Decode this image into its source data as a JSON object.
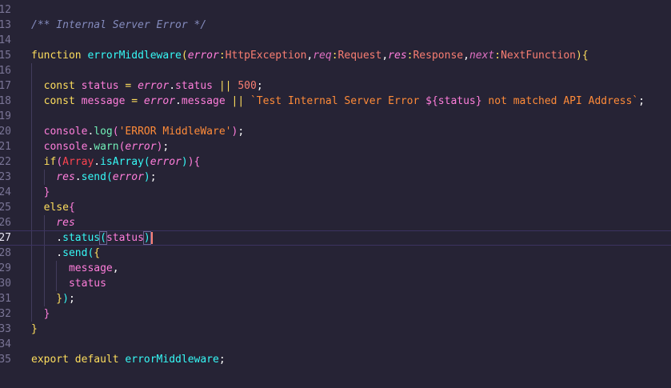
{
  "editor": {
    "language": "typescript",
    "active_line": "27",
    "colors": {
      "background": "#262335",
      "line_number": "#7a7596",
      "comment": "#848bbd",
      "keyword": "#fede5d",
      "function": "#36f9f6",
      "parameter": "#ff7edb",
      "type": "#fe4450",
      "string": "#ff8b39",
      "number": "#f97e72",
      "cursor": "#f97e72"
    },
    "lines": [
      {
        "num": "12",
        "tokens": []
      },
      {
        "num": "13",
        "tokens": [
          {
            "t": "/** Internal Server Error */",
            "c": "t-comment"
          }
        ]
      },
      {
        "num": "14",
        "tokens": []
      },
      {
        "num": "15",
        "tokens": [
          {
            "t": "function ",
            "c": "t-kw"
          },
          {
            "t": "errorMiddleware",
            "c": "t-fn"
          },
          {
            "t": "(",
            "c": "t-brace"
          },
          {
            "t": "error",
            "c": "t-param"
          },
          {
            "t": ":",
            "c": "t-op"
          },
          {
            "t": "HttpException",
            "c": "t-type2"
          },
          {
            "t": ",",
            "c": "t-punc"
          },
          {
            "t": "req",
            "c": "t-param-c"
          },
          {
            "t": ":",
            "c": "t-op"
          },
          {
            "t": "Request",
            "c": "t-type2"
          },
          {
            "t": ",",
            "c": "t-punc"
          },
          {
            "t": "res",
            "c": "t-param"
          },
          {
            "t": ":",
            "c": "t-op"
          },
          {
            "t": "Response",
            "c": "t-type2"
          },
          {
            "t": ",",
            "c": "t-punc"
          },
          {
            "t": "next",
            "c": "t-param-c"
          },
          {
            "t": ":",
            "c": "t-op"
          },
          {
            "t": "NextFunction",
            "c": "t-type2"
          },
          {
            "t": "){",
            "c": "t-brace"
          }
        ]
      },
      {
        "num": "16",
        "tokens": []
      },
      {
        "num": "17",
        "tokens": [
          {
            "t": "  const ",
            "c": "t-kw"
          },
          {
            "t": "status ",
            "c": "t-prop"
          },
          {
            "t": "= ",
            "c": "t-op"
          },
          {
            "t": "error",
            "c": "t-param"
          },
          {
            "t": ".",
            "c": "t-punc"
          },
          {
            "t": "status ",
            "c": "t-prop"
          },
          {
            "t": "|| ",
            "c": "t-op"
          },
          {
            "t": "500",
            "c": "t-num"
          },
          {
            "t": ";",
            "c": "t-punc"
          }
        ]
      },
      {
        "num": "18",
        "tokens": [
          {
            "t": "  const ",
            "c": "t-kw"
          },
          {
            "t": "message ",
            "c": "t-prop"
          },
          {
            "t": "= ",
            "c": "t-op"
          },
          {
            "t": "error",
            "c": "t-param"
          },
          {
            "t": ".",
            "c": "t-punc"
          },
          {
            "t": "message ",
            "c": "t-prop"
          },
          {
            "t": "|| ",
            "c": "t-op"
          },
          {
            "t": "`Test Internal Server Error ",
            "c": "t-str"
          },
          {
            "t": "${",
            "c": "t-brace2"
          },
          {
            "t": "status",
            "c": "t-prop"
          },
          {
            "t": "}",
            "c": "t-brace2"
          },
          {
            "t": " not matched API Address`",
            "c": "t-str"
          },
          {
            "t": ";",
            "c": "t-punc"
          }
        ]
      },
      {
        "num": "19",
        "tokens": []
      },
      {
        "num": "20",
        "tokens": [
          {
            "t": "  console",
            "c": "t-prop"
          },
          {
            "t": ".",
            "c": "t-punc"
          },
          {
            "t": "log",
            "c": "t-fn2"
          },
          {
            "t": "(",
            "c": "t-brace2"
          },
          {
            "t": "'ERROR MiddleWare'",
            "c": "t-str"
          },
          {
            "t": ")",
            "c": "t-brace2"
          },
          {
            "t": ";",
            "c": "t-punc"
          }
        ]
      },
      {
        "num": "21",
        "tokens": [
          {
            "t": "  console",
            "c": "t-prop"
          },
          {
            "t": ".",
            "c": "t-punc"
          },
          {
            "t": "warn",
            "c": "t-fn2"
          },
          {
            "t": "(",
            "c": "t-brace2"
          },
          {
            "t": "error",
            "c": "t-param"
          },
          {
            "t": ")",
            "c": "t-brace2"
          },
          {
            "t": ";",
            "c": "t-punc"
          }
        ]
      },
      {
        "num": "22",
        "tokens": [
          {
            "t": "  if",
            "c": "t-kw"
          },
          {
            "t": "(",
            "c": "t-brace2"
          },
          {
            "t": "Array",
            "c": "t-class"
          },
          {
            "t": ".",
            "c": "t-punc"
          },
          {
            "t": "isArray",
            "c": "t-method"
          },
          {
            "t": "(",
            "c": "t-brace3"
          },
          {
            "t": "error",
            "c": "t-param"
          },
          {
            "t": ")",
            "c": "t-brace3"
          },
          {
            "t": "){",
            "c": "t-brace2"
          }
        ]
      },
      {
        "num": "23",
        "tokens": [
          {
            "t": "    res",
            "c": "t-param"
          },
          {
            "t": ".",
            "c": "t-punc"
          },
          {
            "t": "send",
            "c": "t-method"
          },
          {
            "t": "(",
            "c": "t-brace3"
          },
          {
            "t": "error",
            "c": "t-param"
          },
          {
            "t": ")",
            "c": "t-brace3"
          },
          {
            "t": ";",
            "c": "t-punc"
          }
        ]
      },
      {
        "num": "24",
        "tokens": [
          {
            "t": "  }",
            "c": "t-brace2"
          }
        ]
      },
      {
        "num": "25",
        "tokens": [
          {
            "t": "  else",
            "c": "t-kw"
          },
          {
            "t": "{",
            "c": "t-brace2"
          }
        ]
      },
      {
        "num": "26",
        "tokens": [
          {
            "t": "    res",
            "c": "t-param"
          }
        ]
      },
      {
        "num": "27",
        "tokens": [
          {
            "t": "    .",
            "c": "t-punc"
          },
          {
            "t": "status",
            "c": "t-method"
          },
          {
            "t": "(",
            "c": "t-brace3",
            "match": true
          },
          {
            "t": "status",
            "c": "t-prop"
          },
          {
            "t": ")",
            "c": "t-brace3",
            "match": true
          }
        ],
        "cursor": true
      },
      {
        "num": "28",
        "tokens": [
          {
            "t": "    .",
            "c": "t-punc"
          },
          {
            "t": "send",
            "c": "t-method"
          },
          {
            "t": "(",
            "c": "t-brace3"
          },
          {
            "t": "{",
            "c": "t-brace"
          }
        ]
      },
      {
        "num": "29",
        "tokens": [
          {
            "t": "      message",
            "c": "t-prop"
          },
          {
            "t": ",",
            "c": "t-punc"
          }
        ]
      },
      {
        "num": "30",
        "tokens": [
          {
            "t": "      status",
            "c": "t-prop"
          }
        ]
      },
      {
        "num": "31",
        "tokens": [
          {
            "t": "    }",
            "c": "t-brace"
          },
          {
            "t": ")",
            "c": "t-brace3"
          },
          {
            "t": ";",
            "c": "t-punc"
          }
        ]
      },
      {
        "num": "32",
        "tokens": [
          {
            "t": "  }",
            "c": "t-brace2"
          }
        ]
      },
      {
        "num": "33",
        "tokens": [
          {
            "t": "}",
            "c": "t-brace"
          }
        ]
      },
      {
        "num": "34",
        "tokens": []
      },
      {
        "num": "35",
        "tokens": [
          {
            "t": "export ",
            "c": "t-kw"
          },
          {
            "t": "default ",
            "c": "t-kw"
          },
          {
            "t": "errorMiddleware",
            "c": "t-fn"
          },
          {
            "t": ";",
            "c": "t-punc"
          }
        ]
      }
    ]
  }
}
